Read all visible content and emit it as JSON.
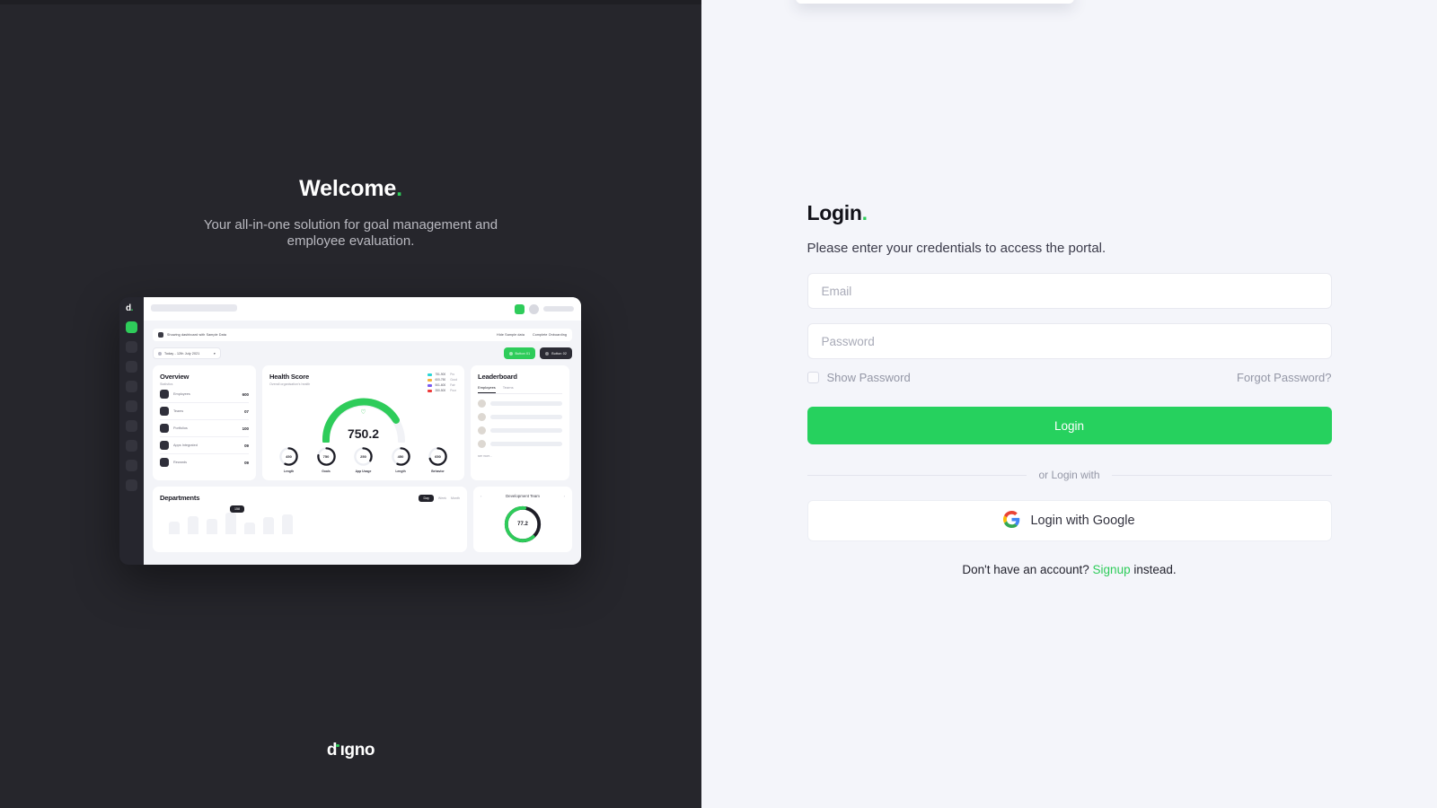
{
  "left": {
    "welcome_title": "Welcome",
    "welcome_title_dot": ".",
    "welcome_subtitle": "Your all-in-one solution for goal management and employee evaluation.",
    "brand": "d",
    "brand_rest": "gno",
    "brand_full": "digno"
  },
  "preview": {
    "logo": "d.",
    "notice": "Showing dashboard with Sample Data",
    "notice_actions": [
      "Hide Sample data",
      "Complete Onboarding"
    ],
    "date_filter": "Today - 12th July 2021",
    "buttons": [
      "Button 01",
      "Button 02"
    ],
    "overview": {
      "title": "Overview",
      "subtitle": "Statistics",
      "rows": [
        {
          "label": "Employees",
          "value": "600"
        },
        {
          "label": "Teams",
          "value": "07"
        },
        {
          "label": "Portfolios",
          "value": "100"
        },
        {
          "label": "Apps Integrated",
          "value": "09"
        },
        {
          "label": "Rewards",
          "value": "09"
        }
      ]
    },
    "health": {
      "title": "Health Score",
      "subtitle": "Overall organisation's health",
      "score": "750.2",
      "legend": [
        {
          "range": "751-900",
          "label": "Pro",
          "color": "#2bd6d6"
        },
        {
          "range": "600-750",
          "label": "Good",
          "color": "#f5b33c"
        },
        {
          "range": "501-600",
          "label": "Fair",
          "color": "#7a5cf0"
        },
        {
          "range": "350-500",
          "label": "Poor",
          "color": "#ee3b3b"
        }
      ],
      "rings": [
        {
          "label": "Length",
          "value": "450"
        },
        {
          "label": "Goals",
          "value": "750"
        },
        {
          "label": "App Usage",
          "value": "250"
        },
        {
          "label": "Length",
          "value": "450"
        },
        {
          "label": "Behavior",
          "value": "650"
        }
      ]
    },
    "leaderboard": {
      "title": "Leaderboard",
      "tabs": [
        "Employees",
        "Teams"
      ],
      "see_more": "see more..."
    },
    "departments": {
      "title": "Departments",
      "pills": [
        "Day",
        "Week",
        "Month"
      ],
      "tooltip": "158"
    },
    "devteam": {
      "title": "Development Team",
      "score": "77.2"
    }
  },
  "login": {
    "title": "Login",
    "title_dot": ".",
    "subtitle": "Please enter your credentials to access the portal.",
    "email": {
      "value": "",
      "placeholder": "Email"
    },
    "password": {
      "value": "",
      "placeholder": "Password"
    },
    "show_password_label": "Show Password",
    "forgot_password": "Forgot Password?",
    "login_button": "Login",
    "divider_text": "or Login with",
    "google_button": "Login with Google",
    "signup_prefix": "Don't have an account? ",
    "signup_link": "Signup",
    "signup_suffix": " instead.",
    "accent_color": "#2ecc5a"
  }
}
